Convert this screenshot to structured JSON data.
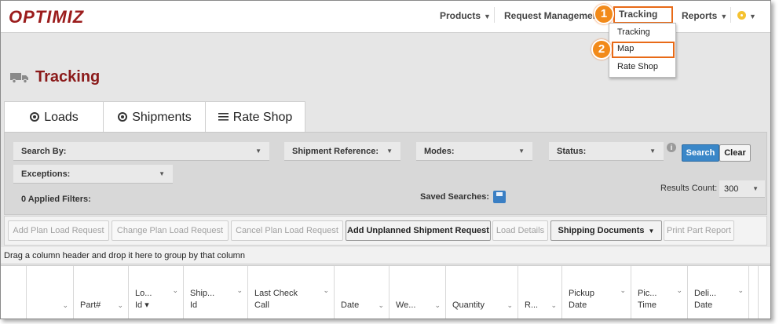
{
  "app": {
    "logo": "OPTIMIZ"
  },
  "topnav": {
    "products": "Products",
    "request_management": "Request Management",
    "tracking": "Tracking",
    "reports": "Reports",
    "caret": "▼"
  },
  "callouts": {
    "one": "1",
    "two": "2"
  },
  "dropdown": {
    "items": [
      "Tracking",
      "Map",
      "Rate Shop"
    ]
  },
  "page": {
    "title": "Tracking"
  },
  "tabs": [
    {
      "label": "Loads",
      "icon": "radio-icon"
    },
    {
      "label": "Shipments",
      "icon": "radio-icon"
    },
    {
      "label": "Rate Shop",
      "icon": "hamburger-icon"
    }
  ],
  "filters": {
    "search_by": "Search By:",
    "shipment_reference": "Shipment Reference:",
    "modes": "Modes:",
    "status": "Status:",
    "exceptions": "Exceptions:",
    "applied_filters": "0 Applied Filters:",
    "saved_searches": "Saved Searches:",
    "results_count_label": "Results Count:",
    "results_count_value": "300",
    "search_button": "Search",
    "clear_button": "Clear",
    "info": "i"
  },
  "toolbar": {
    "buttons": [
      "Add Plan Load Request",
      "Change Plan Load Request",
      "Cancel Plan Load Request",
      "Add Unplanned Shipment Request",
      "Load Details",
      "Shipping Documents",
      "Print Part Report"
    ]
  },
  "grid": {
    "group_hint": "Drag a column header and drop it here to group by that column",
    "columns": [
      {
        "line1": "",
        "line2": ""
      },
      {
        "line1": "",
        "line2": "Part#"
      },
      {
        "line1": "Lo...",
        "line2": "Id ▾"
      },
      {
        "line1": "Ship...",
        "line2": "Id"
      },
      {
        "line1": "Last Check",
        "line2": "Call"
      },
      {
        "line1": "",
        "line2": "Date"
      },
      {
        "line1": "",
        "line2": "We..."
      },
      {
        "line1": "",
        "line2": "Quantity"
      },
      {
        "line1": "",
        "line2": "R..."
      },
      {
        "line1": "Pickup",
        "line2": "Date"
      },
      {
        "line1": "Pic...",
        "line2": "Time"
      },
      {
        "line1": "Deli...",
        "line2": "Date"
      }
    ]
  },
  "colors": {
    "accent_red": "#8b1a1a",
    "callout_orange": "#e86a17",
    "button_blue": "#3a87c8"
  }
}
